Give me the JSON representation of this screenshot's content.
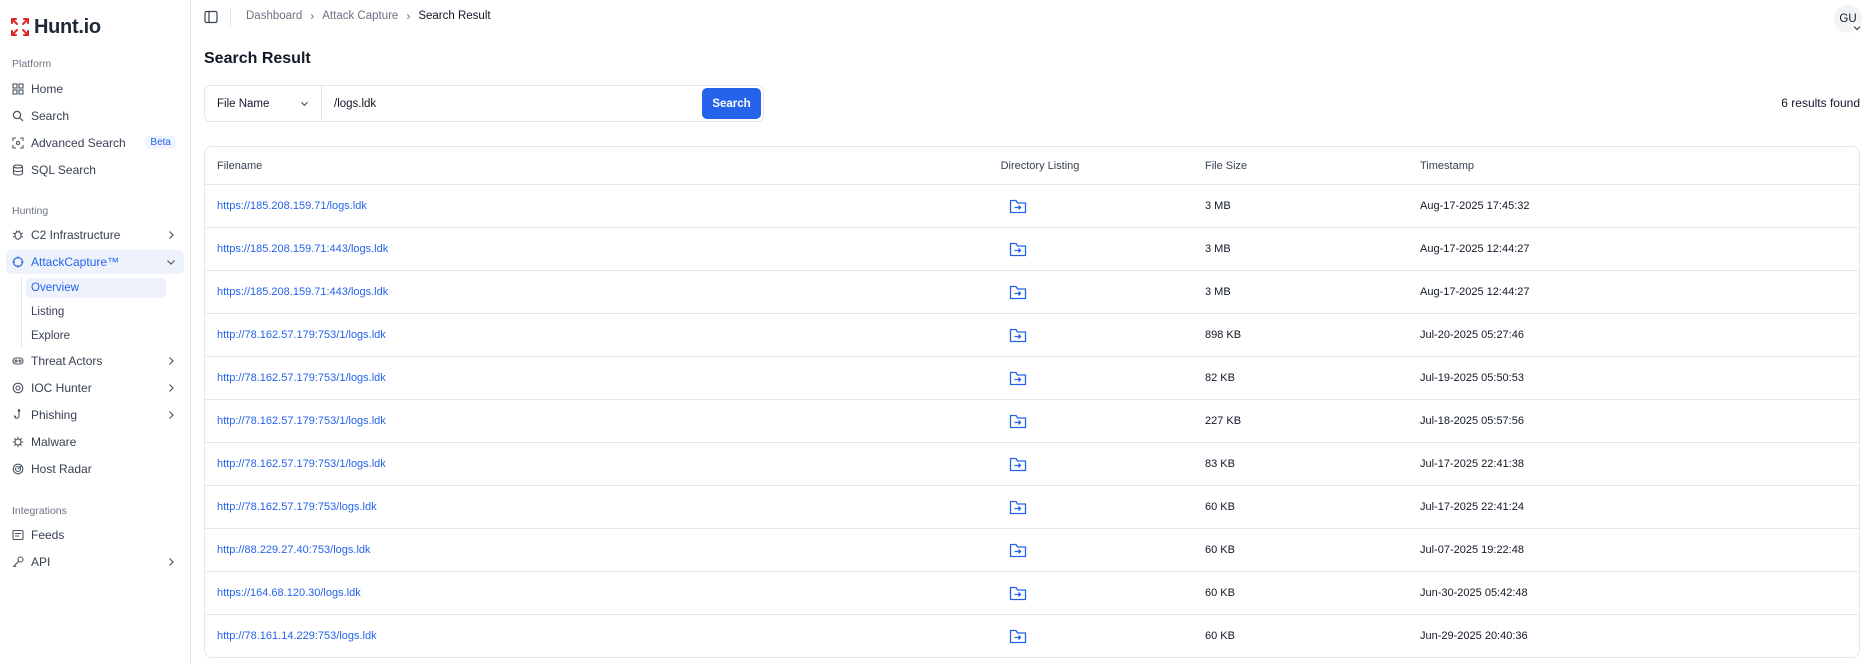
{
  "brand": {
    "name": "Hunt.io",
    "logo_color": "#dc2626"
  },
  "accent": "#2563eb",
  "sidebar": {
    "sections": [
      {
        "label": "Platform"
      },
      {
        "label": "Hunting"
      },
      {
        "label": "Integrations"
      }
    ],
    "platform_items": [
      {
        "label": "Home",
        "icon": "grid-icon"
      },
      {
        "label": "Search",
        "icon": "search-icon"
      },
      {
        "label": "Advanced Search",
        "icon": "scan-icon",
        "badge": "Beta"
      },
      {
        "label": "SQL Search",
        "icon": "database-icon"
      }
    ],
    "hunting_items": [
      {
        "label": "C2 Infrastructure",
        "icon": "bug-icon"
      },
      {
        "label": "AttackCapture™",
        "icon": "crosshair-icon"
      },
      {
        "label": "Threat Actors",
        "icon": "mask-icon"
      },
      {
        "label": "IOC Hunter",
        "icon": "target-icon"
      },
      {
        "label": "Phishing",
        "icon": "hook-icon"
      },
      {
        "label": "Malware",
        "icon": "virus-icon"
      },
      {
        "label": "Host Radar",
        "icon": "radar-icon"
      }
    ],
    "attack_capture_sub": [
      {
        "label": "Overview"
      },
      {
        "label": "Listing"
      },
      {
        "label": "Explore"
      }
    ],
    "integration_items": [
      {
        "label": "Feeds",
        "icon": "feed-icon"
      },
      {
        "label": "API",
        "icon": "key-icon"
      }
    ]
  },
  "breadcrumb": [
    "Dashboard",
    "Attack Capture",
    "Search Result"
  ],
  "user": {
    "initials": "GU"
  },
  "page": {
    "title": "Search Result"
  },
  "search": {
    "field_select": "File Name",
    "query": "/logs.ldk",
    "button": "Search",
    "results_count": "6 results found"
  },
  "table": {
    "headers": [
      "Filename",
      "Directory Listing",
      "File Size",
      "Timestamp"
    ],
    "rows": [
      {
        "filename": "https://185.208.159.71/logs.ldk",
        "size": "3 MB",
        "timestamp": "Aug-17-2025 17:45:32"
      },
      {
        "filename": "https://185.208.159.71:443/logs.ldk",
        "size": "3 MB",
        "timestamp": "Aug-17-2025 12:44:27"
      },
      {
        "filename": "https://185.208.159.71:443/logs.ldk",
        "size": "3 MB",
        "timestamp": "Aug-17-2025 12:44:27"
      },
      {
        "filename": "http://78.162.57.179:753/1/logs.ldk",
        "size": "898 KB",
        "timestamp": "Jul-20-2025 05:27:46"
      },
      {
        "filename": "http://78.162.57.179:753/1/logs.ldk",
        "size": "82 KB",
        "timestamp": "Jul-19-2025 05:50:53"
      },
      {
        "filename": "http://78.162.57.179:753/1/logs.ldk",
        "size": "227 KB",
        "timestamp": "Jul-18-2025 05:57:56"
      },
      {
        "filename": "http://78.162.57.179:753/1/logs.ldk",
        "size": "83 KB",
        "timestamp": "Jul-17-2025 22:41:38"
      },
      {
        "filename": "http://78.162.57.179:753/logs.ldk",
        "size": "60 KB",
        "timestamp": "Jul-17-2025 22:41:24"
      },
      {
        "filename": "http://88.229.27.40:753/logs.ldk",
        "size": "60 KB",
        "timestamp": "Jul-07-2025 19:22:48"
      },
      {
        "filename": "https://164.68.120.30/logs.ldk",
        "size": "60 KB",
        "timestamp": "Jun-30-2025 05:42:48"
      },
      {
        "filename": "http://78.161.14.229:753/logs.ldk",
        "size": "60 KB",
        "timestamp": "Jun-29-2025 20:40:36"
      }
    ]
  }
}
